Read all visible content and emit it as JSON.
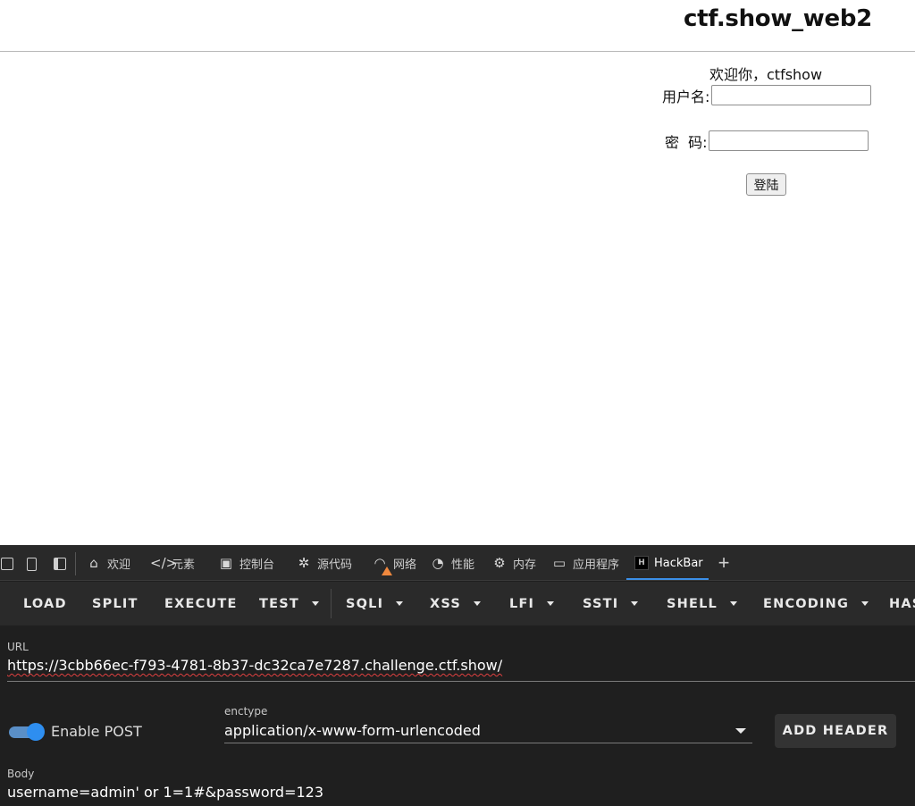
{
  "site": {
    "title": "ctf.show_web2",
    "welcome": "欢迎你，ctfshow",
    "username_label": "用户名:",
    "password_label": "密  码:",
    "username_value": "",
    "password_value": "",
    "login_label": "登陆"
  },
  "devtools": {
    "tabs": [
      {
        "label": "欢迎",
        "icon": "home-icon"
      },
      {
        "label": "元素",
        "icon": "code-icon"
      },
      {
        "label": "控制台",
        "icon": "console-icon"
      },
      {
        "label": "源代码",
        "icon": "bug-icon"
      },
      {
        "label": "网络",
        "icon": "wifi-icon"
      },
      {
        "label": "性能",
        "icon": "gauge-icon"
      },
      {
        "label": "内存",
        "icon": "chip-icon"
      },
      {
        "label": "应用程序",
        "icon": "window-icon"
      },
      {
        "label": "HackBar",
        "icon": "hackbar-logo-icon",
        "active": true
      }
    ],
    "accent_color": "#3b8fe8"
  },
  "hackbar": {
    "toolbar": [
      {
        "label": "LOAD",
        "dropdown": false
      },
      {
        "label": "SPLIT",
        "dropdown": false
      },
      {
        "label": "EXECUTE",
        "dropdown": false
      },
      {
        "label": "TEST",
        "dropdown": true
      },
      {
        "label": "SQLI",
        "dropdown": true
      },
      {
        "label": "XSS",
        "dropdown": true
      },
      {
        "label": "LFI",
        "dropdown": true
      },
      {
        "label": "SSTI",
        "dropdown": true
      },
      {
        "label": "SHELL",
        "dropdown": true
      },
      {
        "label": "ENCODING",
        "dropdown": true
      },
      {
        "label": "HAS",
        "dropdown": false
      }
    ],
    "url_label": "URL",
    "url_value": "https://3cbb66ec-f793-4781-8b37-dc32ca7e7287.challenge.ctf.show/",
    "enable_post_label": "Enable POST",
    "enable_post": true,
    "enctype_label": "enctype",
    "enctype_value": "application/x-www-form-urlencoded",
    "add_header_label": "ADD HEADER",
    "body_label": "Body",
    "body_value": "username=admin' or 1=1#&password=123"
  }
}
